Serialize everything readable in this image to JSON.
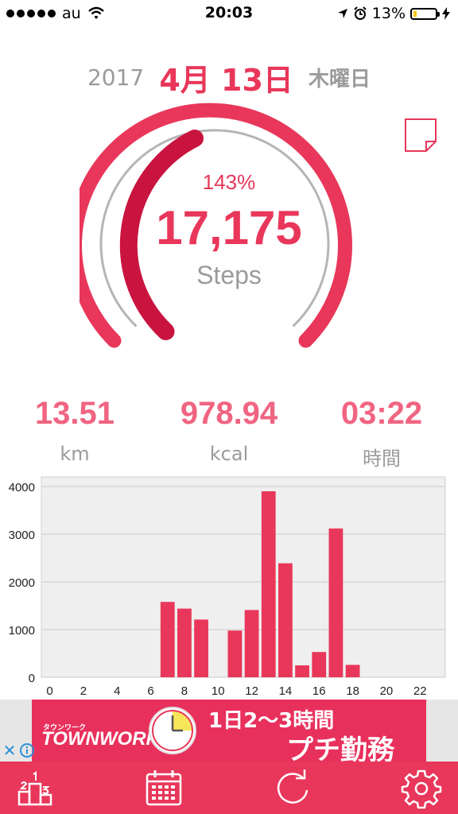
{
  "status_bar": {
    "carrier": "au",
    "time": "20:03",
    "battery_percent": "13%",
    "battery_level": 0.13,
    "signal_bars": 5,
    "icons": [
      "wifi-icon",
      "location-arrow-icon",
      "alarm-icon",
      "charging-bolt-icon"
    ]
  },
  "date": {
    "year": "2017",
    "month_day": "4月 13日",
    "weekday": "木曜日"
  },
  "gauge": {
    "percent_label": "143%",
    "steps": "17,175",
    "steps_label": "Steps",
    "goal_progress": 1.43
  },
  "stats": [
    {
      "value": "13.51",
      "unit": "km"
    },
    {
      "value": "978.94",
      "unit": "kcal"
    },
    {
      "value": "03:22",
      "unit": "時間"
    }
  ],
  "chart_data": {
    "type": "bar",
    "x": [
      0,
      1,
      2,
      3,
      4,
      5,
      6,
      7,
      8,
      9,
      10,
      11,
      12,
      13,
      14,
      15,
      16,
      17,
      18,
      19,
      20,
      21,
      22,
      23
    ],
    "values": [
      0,
      0,
      0,
      0,
      0,
      0,
      0,
      1580,
      1440,
      1210,
      0,
      980,
      1410,
      3900,
      2390,
      250,
      530,
      3120,
      260,
      0,
      0,
      0,
      0,
      0
    ],
    "x_ticks": [
      "0",
      "2",
      "4",
      "6",
      "8",
      "10",
      "12",
      "14",
      "16",
      "18",
      "20",
      "22"
    ],
    "y_ticks": [
      "0",
      "1000",
      "2000",
      "3000",
      "4000"
    ],
    "ylim": [
      0,
      4200
    ],
    "grid": true,
    "bar_color": "#e8375a",
    "plot_background": "#efefef",
    "xlabel": "",
    "ylabel": "",
    "title": ""
  },
  "ad": {
    "brand_small": "タウンワーク",
    "brand": "TOWNWORK",
    "headline": "1日2〜3時間",
    "tagline": "プチ勤務"
  },
  "tabbar": {
    "items": [
      "ranking-icon",
      "calendar-icon",
      "refresh-icon",
      "settings-gear-icon"
    ]
  },
  "colors": {
    "accent": "#e8375a",
    "accent_dark": "#c91440",
    "gray_text": "#9b9b9b"
  }
}
